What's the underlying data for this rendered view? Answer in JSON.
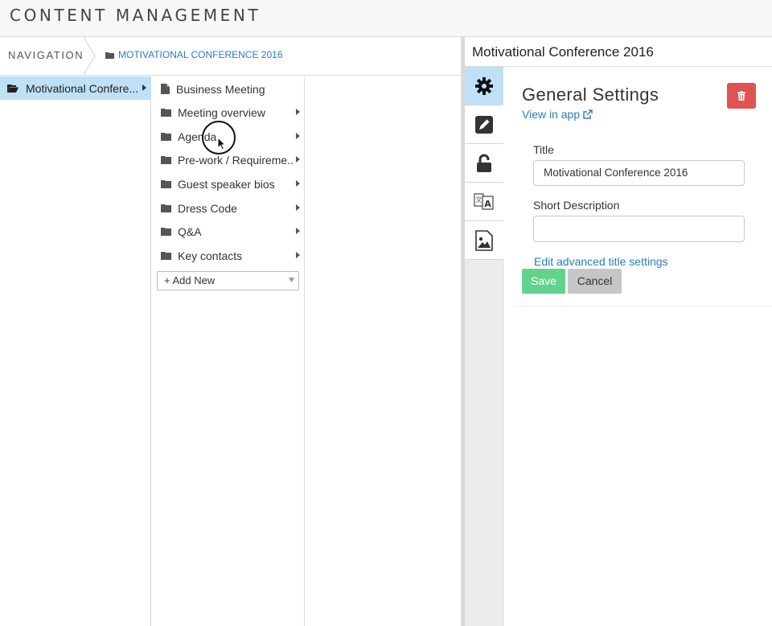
{
  "app": {
    "title": "CONTENT MANAGEMENT"
  },
  "breadcrumb": {
    "root": "NAVIGATION",
    "current": "MOTIVATIONAL CONFERENCE 2016"
  },
  "column1": {
    "selected_label": "Motivational Confere..."
  },
  "column2": {
    "items": [
      {
        "label": "Business Meeting",
        "icon": "document-icon",
        "has_children": false
      },
      {
        "label": "Meeting overview",
        "icon": "folder-icon",
        "has_children": true
      },
      {
        "label": "Agenda",
        "icon": "folder-icon",
        "has_children": true
      },
      {
        "label": "Pre-work / Requireme..",
        "icon": "folder-icon",
        "has_children": true
      },
      {
        "label": "Guest speaker bios",
        "icon": "folder-icon",
        "has_children": true
      },
      {
        "label": "Dress Code",
        "icon": "folder-icon",
        "has_children": true
      },
      {
        "label": "Q&A",
        "icon": "folder-icon",
        "has_children": true
      },
      {
        "label": "Key contacts",
        "icon": "folder-icon",
        "has_children": true
      }
    ],
    "add_new_label": "+ Add New"
  },
  "right_panel": {
    "header_title": "Motivational Conference 2016",
    "tabs": [
      "gear-icon",
      "pencil-icon",
      "unlock-icon",
      "translate-icon",
      "image-icon"
    ],
    "section_title": "General Settings",
    "view_in_app": "View in app",
    "title_label": "Title",
    "title_value": "Motivational Conference 2016",
    "short_description_label": "Short Description",
    "short_description_value": "",
    "advanced_link": "Edit advanced title settings",
    "save_label": "Save",
    "cancel_label": "Cancel"
  },
  "colors": {
    "accent": "#2b7bbf",
    "selected_bg": "#bfe0f7",
    "save": "#62d38d",
    "delete": "#e05353",
    "cancel": "#c6c6c6"
  }
}
